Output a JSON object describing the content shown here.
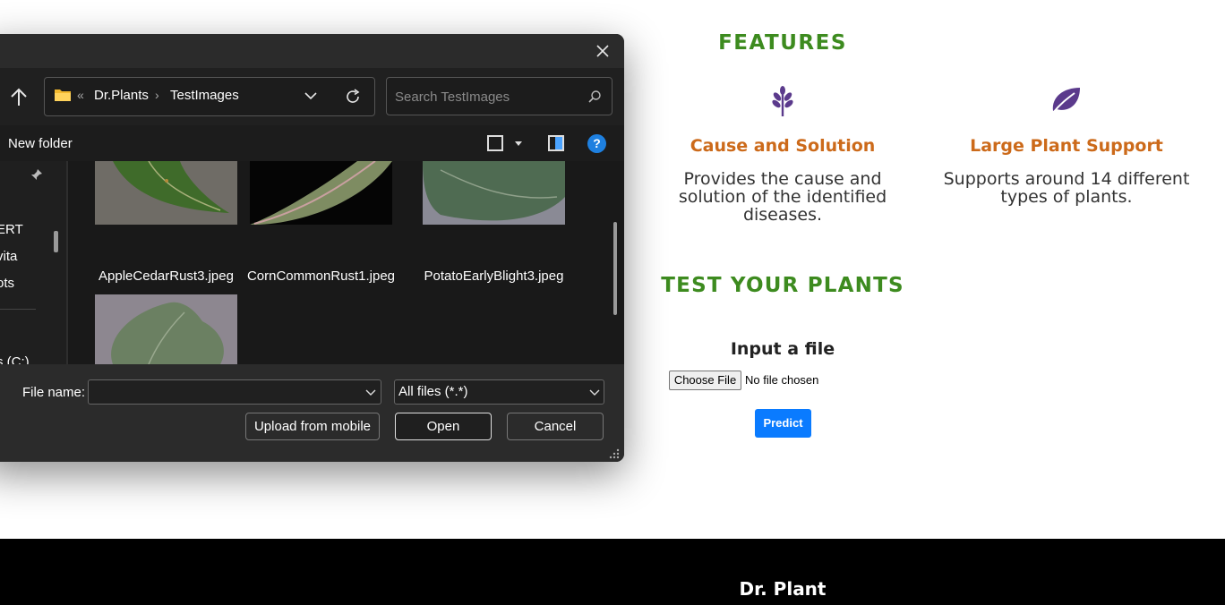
{
  "features": {
    "title": "FEATURES",
    "items": [
      {
        "icon": "leaf-sprig-icon",
        "heading": "Cause and Solution",
        "description": "Provides the cause and solution of the identified diseases."
      },
      {
        "icon": "leaf-icon",
        "heading": "Large Plant Support",
        "description": "Supports around 14 different types of plants."
      }
    ]
  },
  "test": {
    "title": "TEST YOUR PLANTS",
    "input_label": "Input a file",
    "choose_button": "Choose File",
    "no_file_text": "No file chosen",
    "predict_button": "Predict"
  },
  "footer": {
    "title": "Dr. Plant"
  },
  "dialog": {
    "breadcrumb": [
      "Dr.Plants",
      "TestImages"
    ],
    "search_placeholder": "Search TestImages",
    "new_folder": "New folder",
    "nav_items": [
      "ERT",
      "vita",
      "ots",
      "s (C:)"
    ],
    "files": [
      {
        "name": "AppleCedarRust3.jpeg"
      },
      {
        "name": "CornCommonRust1.jpeg"
      },
      {
        "name": "PotatoEarlyBlight3.jpeg"
      },
      {
        "name": ""
      }
    ],
    "file_name_label": "File name:",
    "file_name_value": "",
    "file_type": "All files (*.*)",
    "upload_button": "Upload from mobile",
    "open_button": "Open",
    "cancel_button": "Cancel"
  },
  "colors": {
    "green_heading": "#3d8b1f",
    "orange_heading": "#cc6a1a",
    "icon_purple": "#5b3a8c",
    "predict_blue": "#0a7bff",
    "dialog_bg": "#202020"
  }
}
